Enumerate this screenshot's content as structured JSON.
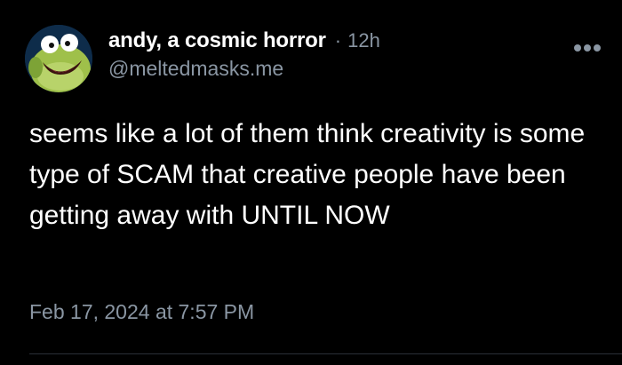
{
  "post": {
    "author": {
      "display_name": "andy, a cosmic horror",
      "handle": "@meltedmasks.me",
      "avatar_icon": "cartoon-fish-avatar-icon"
    },
    "separator": "·",
    "time_ago": "12h",
    "more_icon": "ellipsis-icon",
    "text": "seems like a lot of them think creativity is some type of SCAM that creative people have been getting away with UNTIL NOW",
    "timestamp": "Feb 17, 2024 at 7:57 PM"
  },
  "colors": {
    "background": "#000000",
    "primary_text": "#ffffff",
    "secondary_text": "#8a96a3",
    "divider": "#2a3038"
  }
}
